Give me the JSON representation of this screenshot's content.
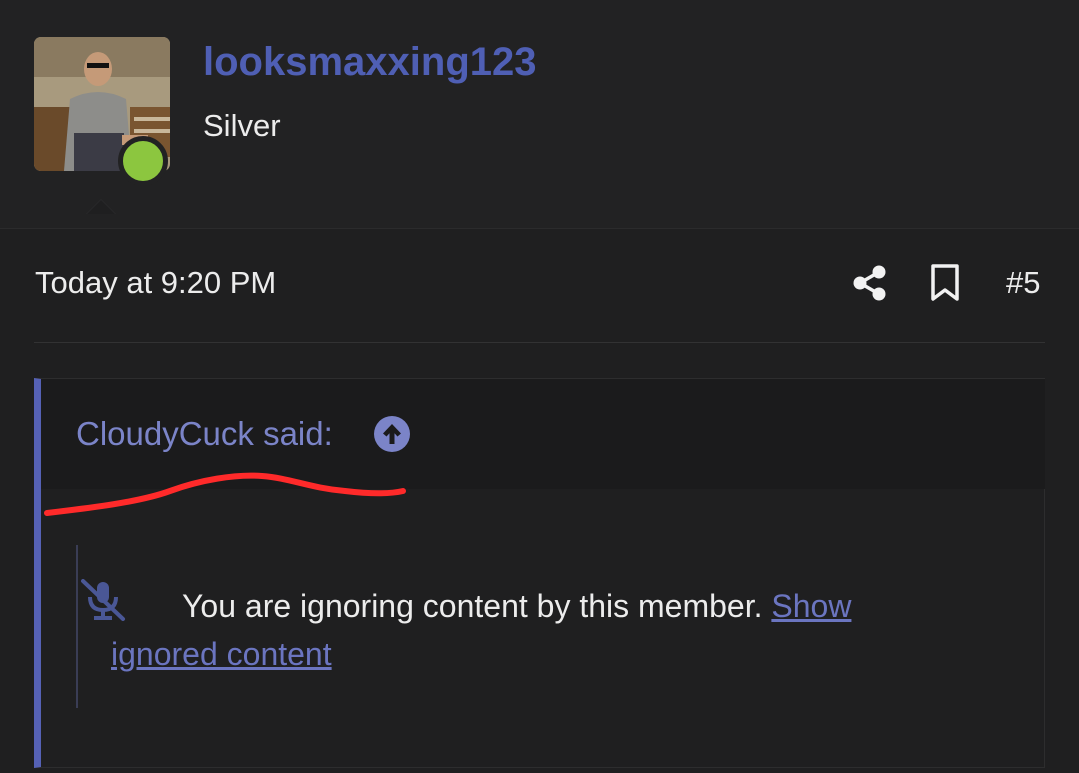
{
  "user": {
    "name": "looksmaxxing123",
    "rank": "Silver",
    "online": true,
    "avatar_icon": "user-avatar-photo"
  },
  "post": {
    "date": "Today at 9:20 PM",
    "number": "#5",
    "share_icon": "share-icon",
    "bookmark_icon": "bookmark-icon"
  },
  "quote": {
    "author_said": "CloudyCuck said:",
    "jump_icon": "arrow-up-circle-icon",
    "ignored_message": "You are ignoring content by this member.",
    "ignored_link": "Show ignored content",
    "mute_icon": "microphone-slash-icon"
  },
  "colors": {
    "background": "#1f1f20",
    "accent": "#4f5fb4",
    "quote_bar": "#5561b5",
    "online": "#8cc63f",
    "scribble": "#ff2a2a"
  }
}
